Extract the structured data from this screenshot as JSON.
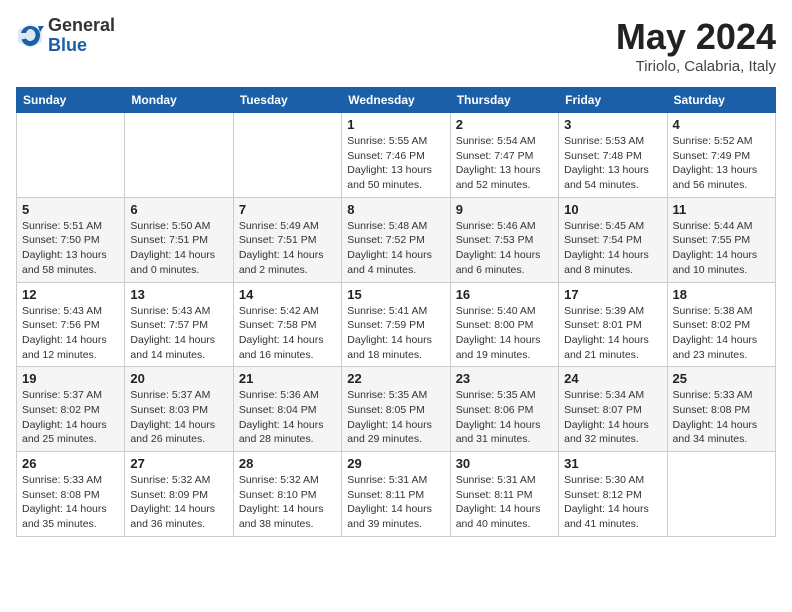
{
  "header": {
    "logo_general": "General",
    "logo_blue": "Blue",
    "month_year": "May 2024",
    "location": "Tiriolo, Calabria, Italy"
  },
  "days_of_week": [
    "Sunday",
    "Monday",
    "Tuesday",
    "Wednesday",
    "Thursday",
    "Friday",
    "Saturday"
  ],
  "weeks": [
    [
      {
        "day": "",
        "info": ""
      },
      {
        "day": "",
        "info": ""
      },
      {
        "day": "",
        "info": ""
      },
      {
        "day": "1",
        "info": "Sunrise: 5:55 AM\nSunset: 7:46 PM\nDaylight: 13 hours\nand 50 minutes."
      },
      {
        "day": "2",
        "info": "Sunrise: 5:54 AM\nSunset: 7:47 PM\nDaylight: 13 hours\nand 52 minutes."
      },
      {
        "day": "3",
        "info": "Sunrise: 5:53 AM\nSunset: 7:48 PM\nDaylight: 13 hours\nand 54 minutes."
      },
      {
        "day": "4",
        "info": "Sunrise: 5:52 AM\nSunset: 7:49 PM\nDaylight: 13 hours\nand 56 minutes."
      }
    ],
    [
      {
        "day": "5",
        "info": "Sunrise: 5:51 AM\nSunset: 7:50 PM\nDaylight: 13 hours\nand 58 minutes."
      },
      {
        "day": "6",
        "info": "Sunrise: 5:50 AM\nSunset: 7:51 PM\nDaylight: 14 hours\nand 0 minutes."
      },
      {
        "day": "7",
        "info": "Sunrise: 5:49 AM\nSunset: 7:51 PM\nDaylight: 14 hours\nand 2 minutes."
      },
      {
        "day": "8",
        "info": "Sunrise: 5:48 AM\nSunset: 7:52 PM\nDaylight: 14 hours\nand 4 minutes."
      },
      {
        "day": "9",
        "info": "Sunrise: 5:46 AM\nSunset: 7:53 PM\nDaylight: 14 hours\nand 6 minutes."
      },
      {
        "day": "10",
        "info": "Sunrise: 5:45 AM\nSunset: 7:54 PM\nDaylight: 14 hours\nand 8 minutes."
      },
      {
        "day": "11",
        "info": "Sunrise: 5:44 AM\nSunset: 7:55 PM\nDaylight: 14 hours\nand 10 minutes."
      }
    ],
    [
      {
        "day": "12",
        "info": "Sunrise: 5:43 AM\nSunset: 7:56 PM\nDaylight: 14 hours\nand 12 minutes."
      },
      {
        "day": "13",
        "info": "Sunrise: 5:43 AM\nSunset: 7:57 PM\nDaylight: 14 hours\nand 14 minutes."
      },
      {
        "day": "14",
        "info": "Sunrise: 5:42 AM\nSunset: 7:58 PM\nDaylight: 14 hours\nand 16 minutes."
      },
      {
        "day": "15",
        "info": "Sunrise: 5:41 AM\nSunset: 7:59 PM\nDaylight: 14 hours\nand 18 minutes."
      },
      {
        "day": "16",
        "info": "Sunrise: 5:40 AM\nSunset: 8:00 PM\nDaylight: 14 hours\nand 19 minutes."
      },
      {
        "day": "17",
        "info": "Sunrise: 5:39 AM\nSunset: 8:01 PM\nDaylight: 14 hours\nand 21 minutes."
      },
      {
        "day": "18",
        "info": "Sunrise: 5:38 AM\nSunset: 8:02 PM\nDaylight: 14 hours\nand 23 minutes."
      }
    ],
    [
      {
        "day": "19",
        "info": "Sunrise: 5:37 AM\nSunset: 8:02 PM\nDaylight: 14 hours\nand 25 minutes."
      },
      {
        "day": "20",
        "info": "Sunrise: 5:37 AM\nSunset: 8:03 PM\nDaylight: 14 hours\nand 26 minutes."
      },
      {
        "day": "21",
        "info": "Sunrise: 5:36 AM\nSunset: 8:04 PM\nDaylight: 14 hours\nand 28 minutes."
      },
      {
        "day": "22",
        "info": "Sunrise: 5:35 AM\nSunset: 8:05 PM\nDaylight: 14 hours\nand 29 minutes."
      },
      {
        "day": "23",
        "info": "Sunrise: 5:35 AM\nSunset: 8:06 PM\nDaylight: 14 hours\nand 31 minutes."
      },
      {
        "day": "24",
        "info": "Sunrise: 5:34 AM\nSunset: 8:07 PM\nDaylight: 14 hours\nand 32 minutes."
      },
      {
        "day": "25",
        "info": "Sunrise: 5:33 AM\nSunset: 8:08 PM\nDaylight: 14 hours\nand 34 minutes."
      }
    ],
    [
      {
        "day": "26",
        "info": "Sunrise: 5:33 AM\nSunset: 8:08 PM\nDaylight: 14 hours\nand 35 minutes."
      },
      {
        "day": "27",
        "info": "Sunrise: 5:32 AM\nSunset: 8:09 PM\nDaylight: 14 hours\nand 36 minutes."
      },
      {
        "day": "28",
        "info": "Sunrise: 5:32 AM\nSunset: 8:10 PM\nDaylight: 14 hours\nand 38 minutes."
      },
      {
        "day": "29",
        "info": "Sunrise: 5:31 AM\nSunset: 8:11 PM\nDaylight: 14 hours\nand 39 minutes."
      },
      {
        "day": "30",
        "info": "Sunrise: 5:31 AM\nSunset: 8:11 PM\nDaylight: 14 hours\nand 40 minutes."
      },
      {
        "day": "31",
        "info": "Sunrise: 5:30 AM\nSunset: 8:12 PM\nDaylight: 14 hours\nand 41 minutes."
      },
      {
        "day": "",
        "info": ""
      }
    ]
  ]
}
